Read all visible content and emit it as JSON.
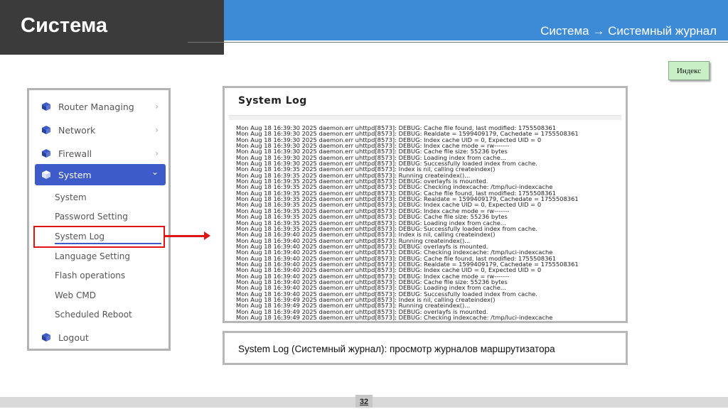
{
  "header": {
    "title": "Система",
    "breadcrumb": "Система → Системный журнал"
  },
  "index_button": {
    "label": "Индекс"
  },
  "sidebar": {
    "items": [
      {
        "label": "Router Managing",
        "icon": "cube-icon",
        "chevron": "›"
      },
      {
        "label": "Network",
        "icon": "cube-icon",
        "chevron": "›"
      },
      {
        "label": "Firewall",
        "icon": "cube-icon",
        "chevron": "›"
      },
      {
        "label": "System",
        "icon": "cube-icon",
        "chevron": "⌄",
        "active": true
      },
      {
        "label": "Logout",
        "icon": "cube-icon"
      }
    ],
    "system_submenu": [
      "System",
      "Password Setting",
      "System Log",
      "Language Setting",
      "Flash operations",
      "Web CMD",
      "Scheduled Reboot"
    ]
  },
  "log_panel": {
    "title": "System Log",
    "lines": [
      "Mon Aug 18 16:39:30 2025 daemon.err uhttpd[8573]: DEBUG: Cache file found, last modified: 1755508361",
      "Mon Aug 18 16:39:30 2025 daemon.err uhttpd[8573]: DEBUG: Realdate = 1599409179, Cachedate = 1755508361",
      "Mon Aug 18 16:39:30 2025 daemon.err uhttpd[8573]: DEBUG: Index cache UID = 0, Expected UID = 0",
      "Mon Aug 18 16:39:30 2025 daemon.err uhttpd[8573]: DEBUG: Index cache mode = rw-------",
      "Mon Aug 18 16:39:30 2025 daemon.err uhttpd[8573]: DEBUG: Cache file size: 55236 bytes",
      "Mon Aug 18 16:39:30 2025 daemon.err uhttpd[8573]: DEBUG: Loading index from cache...",
      "Mon Aug 18 16:39:30 2025 daemon.err uhttpd[8573]: DEBUG: Successfully loaded index from cache.",
      "Mon Aug 18 16:39:35 2025 daemon.err uhttpd[8573]: Index is nil, calling createindex()",
      "Mon Aug 18 16:39:35 2025 daemon.err uhttpd[8573]: Running createindex()...",
      "Mon Aug 18 16:39:35 2025 daemon.err uhttpd[8573]: DEBUG: overlayfs is mounted.",
      "Mon Aug 18 16:39:35 2025 daemon.err uhttpd[8573]: DEBUG: Checking indexcache: /tmp/luci-indexcache",
      "Mon Aug 18 16:39:35 2025 daemon.err uhttpd[8573]: DEBUG: Cache file found, last modified: 1755508361",
      "Mon Aug 18 16:39:35 2025 daemon.err uhttpd[8573]: DEBUG: Realdate = 1599409179, Cachedate = 1755508361",
      "Mon Aug 18 16:39:35 2025 daemon.err uhttpd[8573]: DEBUG: Index cache UID = 0, Expected UID = 0",
      "Mon Aug 18 16:39:35 2025 daemon.err uhttpd[8573]: DEBUG: Index cache mode = rw-------",
      "Mon Aug 18 16:39:35 2025 daemon.err uhttpd[8573]: DEBUG: Cache file size: 55236 bytes",
      "Mon Aug 18 16:39:35 2025 daemon.err uhttpd[8573]: DEBUG: Loading index from cache...",
      "Mon Aug 18 16:39:35 2025 daemon.err uhttpd[8573]: DEBUG: Successfully loaded index from cache.",
      "Mon Aug 18 16:39:40 2025 daemon.err uhttpd[8573]: Index is nil, calling createindex()",
      "Mon Aug 18 16:39:40 2025 daemon.err uhttpd[8573]: Running createindex()...",
      "Mon Aug 18 16:39:40 2025 daemon.err uhttpd[8573]: DEBUG: overlayfs is mounted.",
      "Mon Aug 18 16:39:40 2025 daemon.err uhttpd[8573]: DEBUG: Checking indexcache: /tmp/luci-indexcache",
      "Mon Aug 18 16:39:40 2025 daemon.err uhttpd[8573]: DEBUG: Cache file found, last modified: 1755508361",
      "Mon Aug 18 16:39:40 2025 daemon.err uhttpd[8573]: DEBUG: Realdate = 1599409179, Cachedate = 1755508361",
      "Mon Aug 18 16:39:40 2025 daemon.err uhttpd[8573]: DEBUG: Index cache UID = 0, Expected UID = 0",
      "Mon Aug 18 16:39:40 2025 daemon.err uhttpd[8573]: DEBUG: Index cache mode = rw-------",
      "Mon Aug 18 16:39:40 2025 daemon.err uhttpd[8573]: DEBUG: Cache file size: 55236 bytes",
      "Mon Aug 18 16:39:40 2025 daemon.err uhttpd[8573]: DEBUG: Loading index from cache...",
      "Mon Aug 18 16:39:40 2025 daemon.err uhttpd[8573]: DEBUG: Successfully loaded index from cache.",
      "Mon Aug 18 16:39:49 2025 daemon.err uhttpd[8573]: Index is nil, calling createindex()",
      "Mon Aug 18 16:39:49 2025 daemon.err uhttpd[8573]: Running createindex()...",
      "Mon Aug 18 16:39:49 2025 daemon.err uhttpd[8573]: DEBUG: overlayfs is mounted.",
      "Mon Aug 18 16:39:49 2025 daemon.err uhttpd[8573]: DEBUG: Checking indexcache: /tmp/luci-indexcache"
    ]
  },
  "caption": "System Log (Системный журнал): просмотр журналов маршрутизатора",
  "footer": {
    "page_number": "32"
  },
  "colors": {
    "header_dark": "#3b3b3b",
    "header_blue": "#3d8ad7",
    "accent_blue": "#3d5bc9",
    "highlight_red": "#e01616",
    "index_button_bg": "#c9efc7"
  }
}
